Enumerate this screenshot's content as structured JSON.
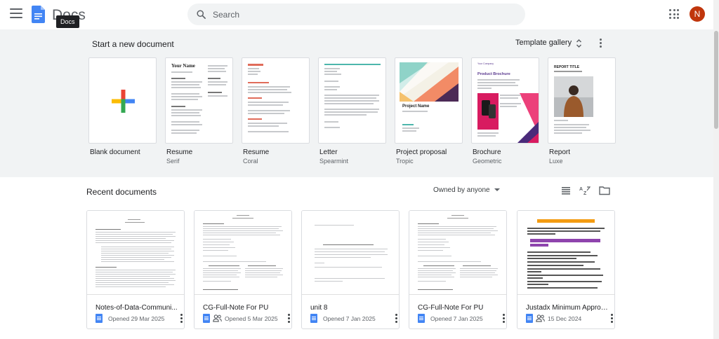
{
  "header": {
    "app_name": "Docs",
    "tooltip": "Docs",
    "search_placeholder": "Search",
    "avatar_letter": "N",
    "avatar_color": "#c0360c"
  },
  "templates": {
    "section_title": "Start a new document",
    "gallery_label": "Template gallery",
    "items": [
      {
        "name": "Blank document",
        "sub": ""
      },
      {
        "name": "Resume",
        "sub": "Serif"
      },
      {
        "name": "Resume",
        "sub": "Coral"
      },
      {
        "name": "Letter",
        "sub": "Spearmint"
      },
      {
        "name": "Project proposal",
        "sub": "Tropic"
      },
      {
        "name": "Brochure",
        "sub": "Geometric"
      },
      {
        "name": "Report",
        "sub": "Luxe"
      }
    ],
    "thumb_text": {
      "resume_serif_heading": "Your Name",
      "proposal_heading": "Project Name",
      "brochure_heading": "Product Brochure",
      "brochure_company": "Your Company",
      "report_heading": "REPORT TITLE"
    }
  },
  "recent": {
    "section_title": "Recent documents",
    "owner_filter": "Owned by anyone",
    "docs": [
      {
        "title": "Notes-of-Data-Communi...",
        "date": "Opened 29 Mar 2025",
        "shared": false
      },
      {
        "title": "CG-Full-Note For PU",
        "date": "Opened 5 Mar 2025",
        "shared": true
      },
      {
        "title": "unit 8",
        "date": "Opened 7 Jan 2025",
        "shared": false
      },
      {
        "title": "CG-Full-Note For PU",
        "date": "Opened 7 Jan 2025",
        "shared": false
      },
      {
        "title": "Justadx Minimum Approv...",
        "date": "15 Dec 2024",
        "shared": true
      }
    ]
  },
  "colors": {
    "accent_blue": "#4285f4",
    "section_bg": "#f1f3f4"
  }
}
